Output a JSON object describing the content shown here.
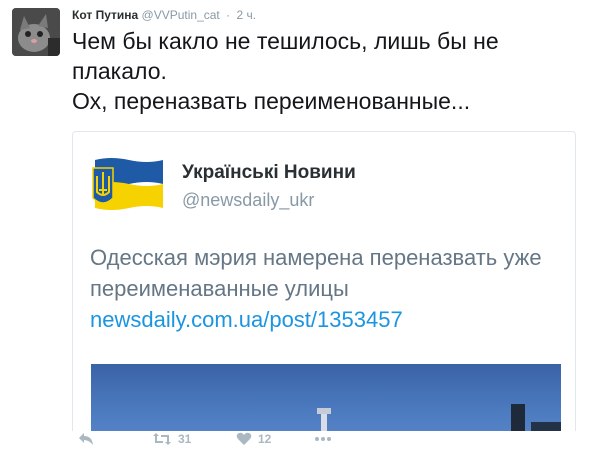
{
  "tweet": {
    "author_name": "Кот Путина",
    "author_handle": "@VVPutin_cat",
    "separator": "·",
    "timestamp": "2 ч.",
    "text_lines": [
      "Чем бы какло не тешилось, лишь бы не",
      "плакало.",
      "Ох, переназвать переименованные..."
    ]
  },
  "quoted": {
    "author_name": "Українські Новини",
    "author_handle": "@newsdaily_ukr",
    "text": "Одесская мэрия намерена переназвать уже переименаванные улицы",
    "link": "newsdaily.com.ua/post/1353457"
  },
  "actions": {
    "reply_icon": "reply-icon",
    "retweet_icon": "retweet-icon",
    "retweet_count": "31",
    "like_icon": "heart-icon",
    "like_count": "12",
    "more_icon": "more-icon"
  },
  "colors": {
    "link": "#1b95e0",
    "muted": "#8899a6",
    "text": "#14171a",
    "flag_blue": "#1f5aa6",
    "flag_yellow": "#f5d200"
  }
}
